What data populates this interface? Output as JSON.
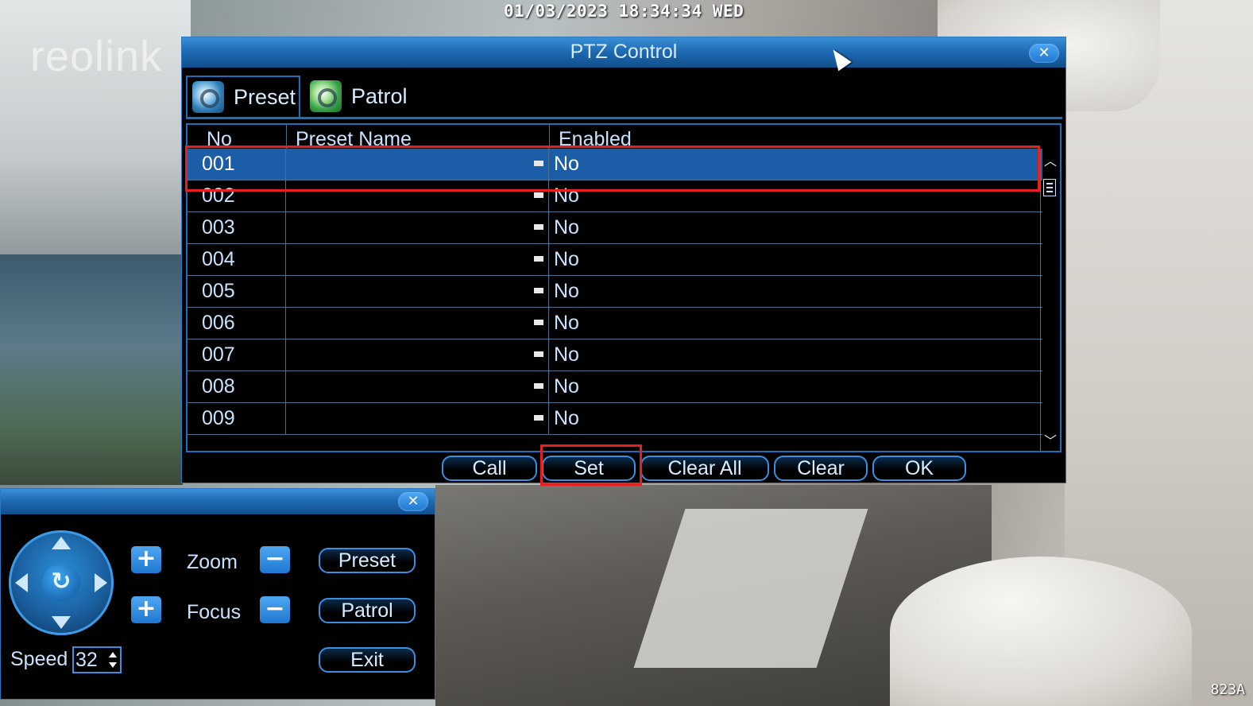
{
  "osd": {
    "datetime": "01/03/2023 18:34:34 WED",
    "camera_id": "823A",
    "logo_text": "reolink"
  },
  "ptz_dialog": {
    "title": "PTZ Control",
    "close_icon": "close-icon",
    "tabs": [
      {
        "label": "Preset",
        "icon": "preset-gear-icon",
        "active": true
      },
      {
        "label": "Patrol",
        "icon": "patrol-gear-icon",
        "active": false
      }
    ],
    "columns": [
      "No",
      "Preset Name",
      "Enabled"
    ],
    "rows": [
      {
        "no": "001",
        "name": "",
        "enabled": "No",
        "selected": true
      },
      {
        "no": "002",
        "name": "",
        "enabled": "No",
        "selected": false
      },
      {
        "no": "003",
        "name": "",
        "enabled": "No",
        "selected": false
      },
      {
        "no": "004",
        "name": "",
        "enabled": "No",
        "selected": false
      },
      {
        "no": "005",
        "name": "",
        "enabled": "No",
        "selected": false
      },
      {
        "no": "006",
        "name": "",
        "enabled": "No",
        "selected": false
      },
      {
        "no": "007",
        "name": "",
        "enabled": "No",
        "selected": false
      },
      {
        "no": "008",
        "name": "",
        "enabled": "No",
        "selected": false
      },
      {
        "no": "009",
        "name": "",
        "enabled": "No",
        "selected": false
      }
    ],
    "buttons": [
      "Call",
      "Set",
      "Clear All",
      "Clear",
      "OK"
    ],
    "highlighted_button": "Set"
  },
  "ptz_panel": {
    "zoom_label": "Zoom",
    "focus_label": "Focus",
    "speed_label": "Speed",
    "speed_value": "32",
    "plus_symbol": "+",
    "minus_symbol": "−",
    "preset_label": "Preset",
    "patrol_label": "Patrol",
    "exit_label": "Exit"
  },
  "colors": {
    "accent": "#1e6fb9",
    "selected_row": "#1c5da8",
    "highlight_outline": "#e62020"
  }
}
